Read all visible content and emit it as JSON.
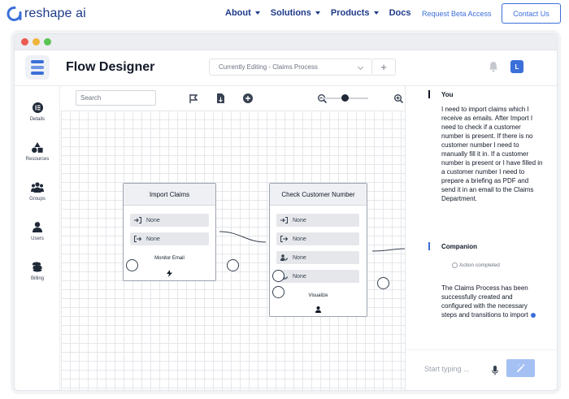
{
  "site": {
    "brand": "reshape ai",
    "nav": [
      {
        "label": "About"
      },
      {
        "label": "Solutions"
      },
      {
        "label": "Products"
      },
      {
        "label": "Docs"
      }
    ],
    "beta_link": "Request Beta Access",
    "contact_label": "Contact Us"
  },
  "app": {
    "title": "Flow Designer",
    "editing": "Currently Editing - Claims Process",
    "add_label": "+",
    "user_initial": "L",
    "accent": "#3b6fd9"
  },
  "sidebar": {
    "items": [
      {
        "label": "Details",
        "icon": "details-icon"
      },
      {
        "label": "Resources",
        "icon": "resources-icon"
      },
      {
        "label": "Groups",
        "icon": "groups-icon"
      },
      {
        "label": "Users",
        "icon": "users-icon"
      },
      {
        "label": "Billing",
        "icon": "billing-icon"
      }
    ]
  },
  "toolbar": {
    "search_placeholder": "Search",
    "zoom_level": 0.5
  },
  "nodes": {
    "import": {
      "title": "Import Claims",
      "ports": [
        "None",
        "None"
      ],
      "footer": "Monitor Email"
    },
    "check": {
      "title": "Check Customer Number",
      "ports": [
        "None",
        "None",
        "None",
        "None"
      ],
      "footer": "Visualize"
    }
  },
  "chat": {
    "user_name": "You",
    "user_message": "I need to import claims which I receive as emails. After Import I need to check if a customer number is present. If there is no customer number I need to manually fill it in. If a customer number is present or I have filled in a customer number I need to prepare a briefing as PDF and send it in an email to the Claims Department.",
    "bot_name": "Companion",
    "action_status": "Action completed",
    "bot_message": "The Claims Process has been successfully created and configured with the necessary steps and transitions to import",
    "input_placeholder": "Start typing ..."
  }
}
